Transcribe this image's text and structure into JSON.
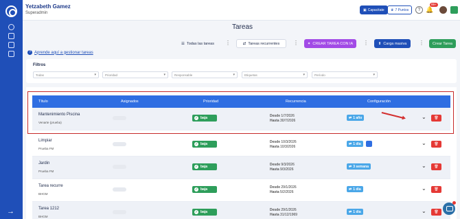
{
  "header": {
    "user_name": "Yetzabeth Gamez",
    "user_role": "Superadmin",
    "training_button": "Capacitate",
    "points_button": "7 Puntos",
    "notifications_badge": "99+"
  },
  "page": {
    "title": "Tareas",
    "guide_link": "Aprende aquí a gestionar tareas"
  },
  "toolbar": {
    "all_tasks": "Todas las tareas",
    "recurring_tasks": "Tareas recurrentes",
    "create_ai": "CREAR TAREA CON IA",
    "bulk_load": "Carga masiva",
    "create_task": "Crear Tarea"
  },
  "filters": {
    "title": "Filtros",
    "selects": [
      "Todas",
      "Prioridad",
      "Responsable",
      "Etiquetas",
      "Período"
    ]
  },
  "table": {
    "headers": [
      "Título",
      "Asignados",
      "Prioridad",
      "Recurrencia",
      "Configuración"
    ],
    "rows": [
      {
        "title": "Mantenimiento Piscina",
        "subtitle": "Venarte (prueba)",
        "priority": "baja",
        "desde": "1/7/2026",
        "hasta": "30/7/2026",
        "config": "1 año",
        "has_extra": false
      },
      {
        "title": "Limpiar",
        "subtitle": "Prueba FM",
        "priority": "baja",
        "desde": "10/3/2026",
        "hasta": "10/3/2026",
        "config": "1 día",
        "has_extra": true
      },
      {
        "title": "Jardin",
        "subtitle": "Prueba FM",
        "priority": "baja",
        "desde": "9/3/2026",
        "hasta": "9/3/2026",
        "config": "3 semana",
        "has_extra": false
      },
      {
        "title": "Tarea recurre",
        "subtitle": "BHGM",
        "priority": "baja",
        "desde": "29/1/2026",
        "hasta": "5/2/2026",
        "config": "1 día",
        "has_extra": false
      },
      {
        "title": "Tarea 1212",
        "subtitle": "BHGM",
        "priority": "baja",
        "desde": "29/1/2026",
        "hasta": "31/12/1969",
        "config": "1 día",
        "has_extra": false
      }
    ],
    "desde_label": "Desde",
    "hasta_label": "Hasta"
  },
  "colors": {
    "sidebar": "#1f4fb8",
    "table_header": "#2f6ee2",
    "priority_low": "#2e9e5b",
    "ai_button": "#a24be6",
    "delete": "#e53935",
    "highlight_outline": "#c62828"
  }
}
